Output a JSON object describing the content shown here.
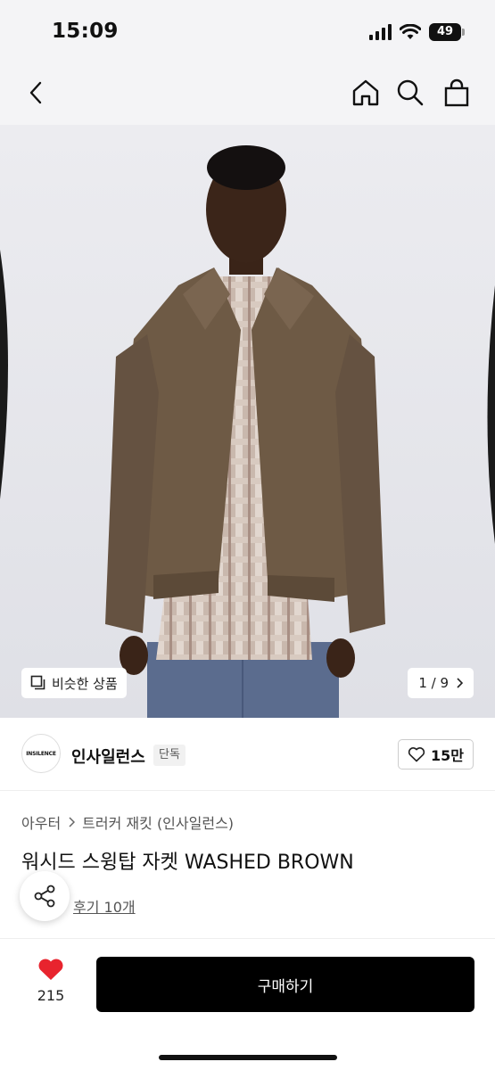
{
  "status_bar": {
    "time": "15:09",
    "battery": "49"
  },
  "nav": {
    "back_icon": "chevron-left-icon",
    "home_icon": "home-icon",
    "search_icon": "search-icon",
    "bag_icon": "shopping-bag-icon"
  },
  "hero": {
    "similar_label": "비슷한 상품",
    "counter": "1 / 9"
  },
  "brand": {
    "logo_text": "INSILENCE",
    "name": "인사일런스",
    "badge": "단독",
    "likes": "15만"
  },
  "product": {
    "category": [
      "아우터",
      "트러커 재킷 (인사일런스)"
    ],
    "title": "워시드 스윙탑 자켓 WASHED BROWN",
    "reviews": "후기 10개"
  },
  "bottom": {
    "heart_count": "215",
    "buy_label": "구매하기"
  },
  "colors": {
    "accent_heart": "#e8242e",
    "buy_bg": "#000000"
  }
}
